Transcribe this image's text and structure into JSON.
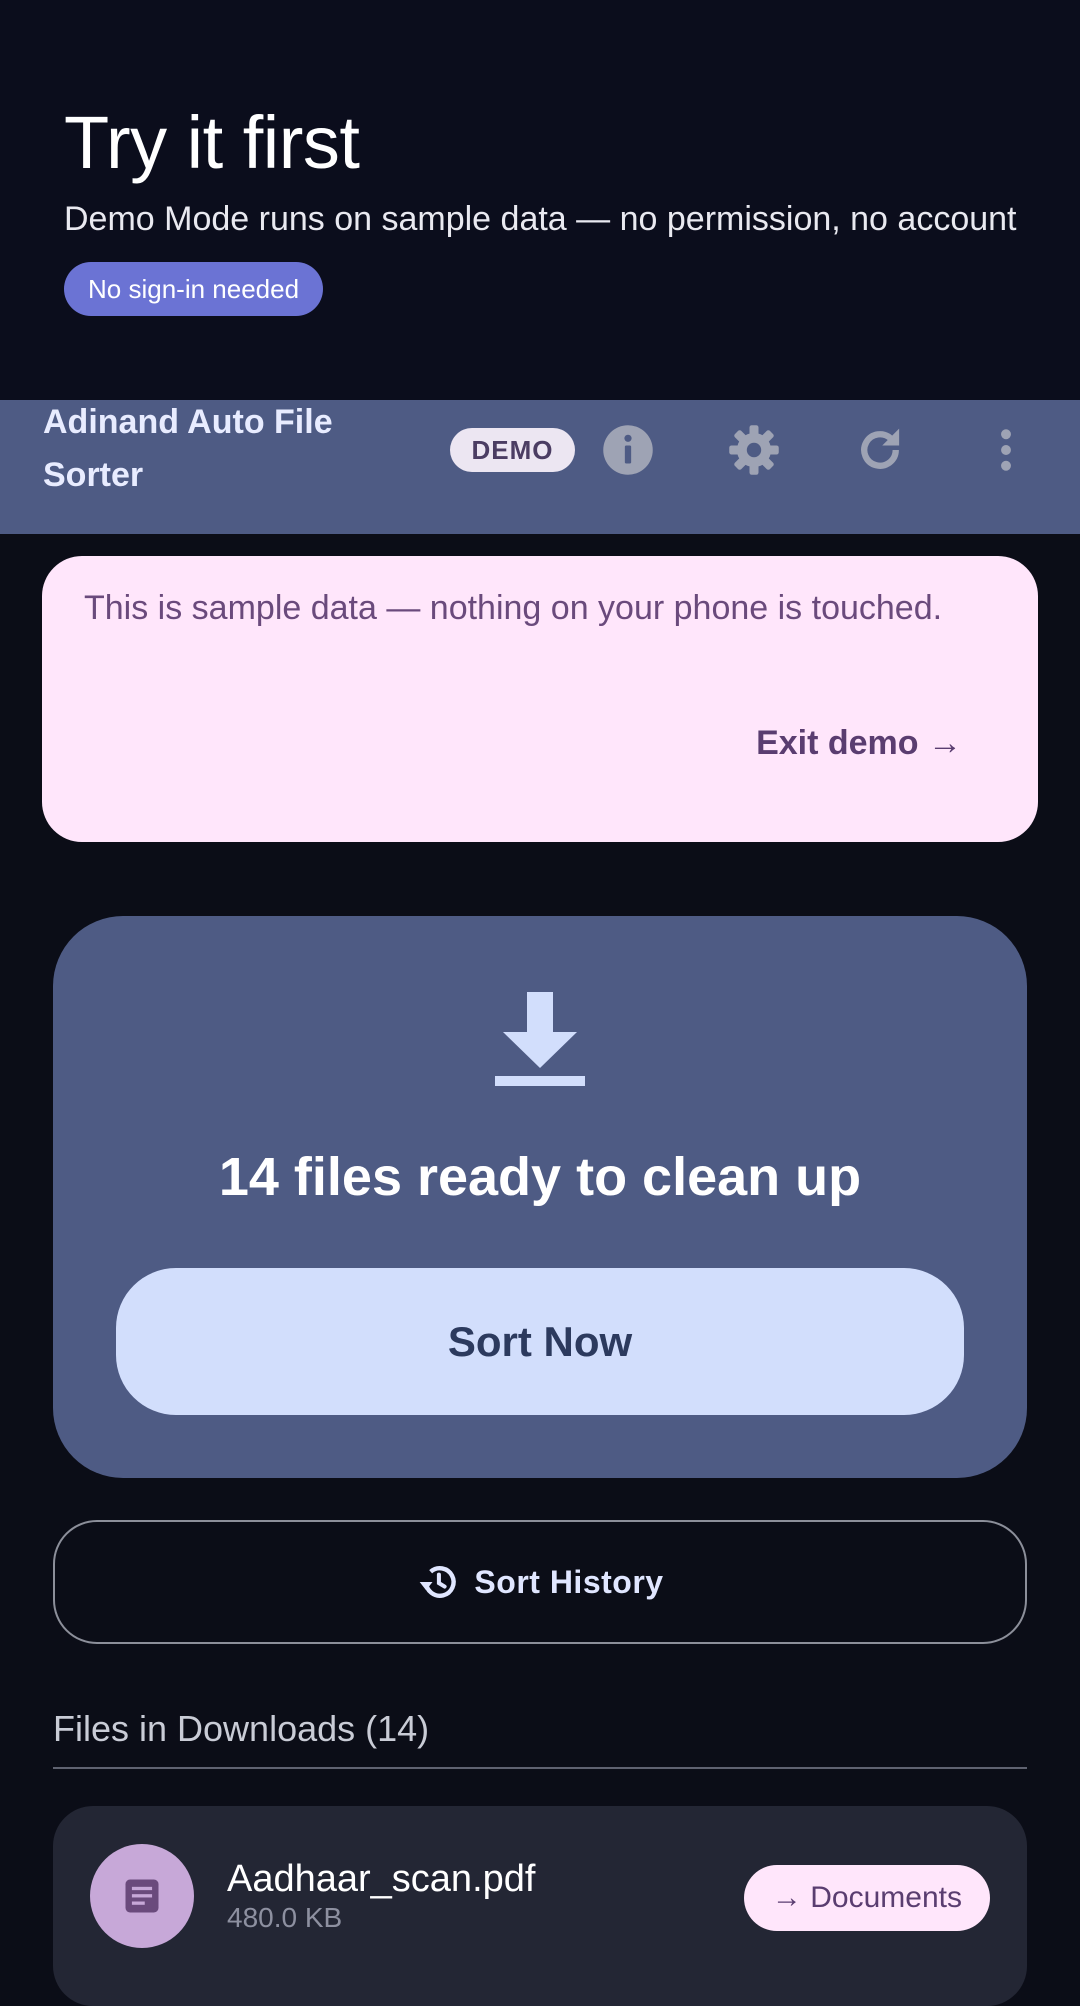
{
  "hero": {
    "title": "Try it first",
    "subtitle": "Demo Mode runs on sample data — no permission, no account",
    "pill": "No sign-in needed"
  },
  "appbar": {
    "title": "Adinand Auto File Sorter",
    "demo_chip": "DEMO",
    "icons": [
      "info-icon",
      "gear-icon",
      "refresh-icon",
      "more-vert-icon"
    ]
  },
  "banner": {
    "text": "This is sample data — nothing on your phone is touched.",
    "exit_label": "Exit demo →"
  },
  "sort_card": {
    "icon": "download-icon",
    "ready_text": "14 files ready to clean up",
    "sort_button": "Sort Now"
  },
  "history": {
    "icon": "history-icon",
    "label": "Sort History"
  },
  "files": {
    "section_title": "Files in Downloads (14)",
    "items": [
      {
        "name": "Aadhaar_scan.pdf",
        "size": "480.0 KB",
        "destination": "→ Documents",
        "icon": "document-icon"
      }
    ]
  },
  "colors": {
    "background": "#0b0d17",
    "appbar": "#4e5b84",
    "accent_pill": "#6b73d4",
    "banner": "#ffe6fb",
    "sort_button": "#d2defc"
  }
}
